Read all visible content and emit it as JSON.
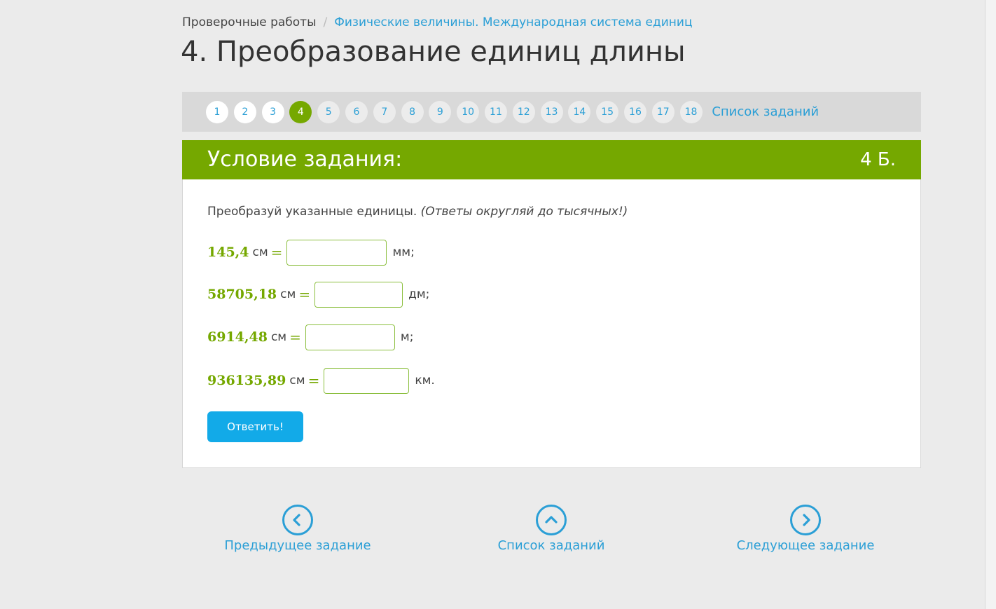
{
  "breadcrumb": {
    "root": "Проверочные работы",
    "separator": "/",
    "current": "Физические величины. Международная система единиц"
  },
  "page_title": "4. Преобразование единиц длины",
  "pager": {
    "numbers": [
      "1",
      "2",
      "3",
      "4",
      "5",
      "6",
      "7",
      "8",
      "9",
      "10",
      "11",
      "12",
      "13",
      "14",
      "15",
      "16",
      "17",
      "18"
    ],
    "active": "4",
    "list_label": "Список заданий"
  },
  "task": {
    "header_title": "Условие задания:",
    "points": "4 Б.",
    "instruction": "Преобразуй указанные единицы.",
    "instruction_note": "(Ответы округляй до тысячных!)",
    "rows": [
      {
        "value": "145,4",
        "from_unit": "см",
        "eq": "=",
        "to_unit": "мм;",
        "input_value": ""
      },
      {
        "value": "58705,18",
        "from_unit": "см",
        "eq": "=",
        "to_unit": "дм;",
        "input_value": ""
      },
      {
        "value": "6914,48",
        "from_unit": "см",
        "eq": "=",
        "to_unit": "м;",
        "input_value": ""
      },
      {
        "value": "936135,89",
        "from_unit": "см",
        "eq": "=",
        "to_unit": "км.",
        "input_value": ""
      }
    ],
    "answer_button": "Ответить!"
  },
  "bottom_nav": {
    "prev": {
      "label": "Предыдущее задание",
      "icon": "chevron-left-icon"
    },
    "list": {
      "label": "Список заданий",
      "icon": "chevron-up-icon"
    },
    "next": {
      "label": "Следующее задание",
      "icon": "chevron-right-icon"
    }
  },
  "colors": {
    "accent_green": "#75a800",
    "link_blue": "#2b9fd6",
    "button_blue": "#12aae8"
  }
}
